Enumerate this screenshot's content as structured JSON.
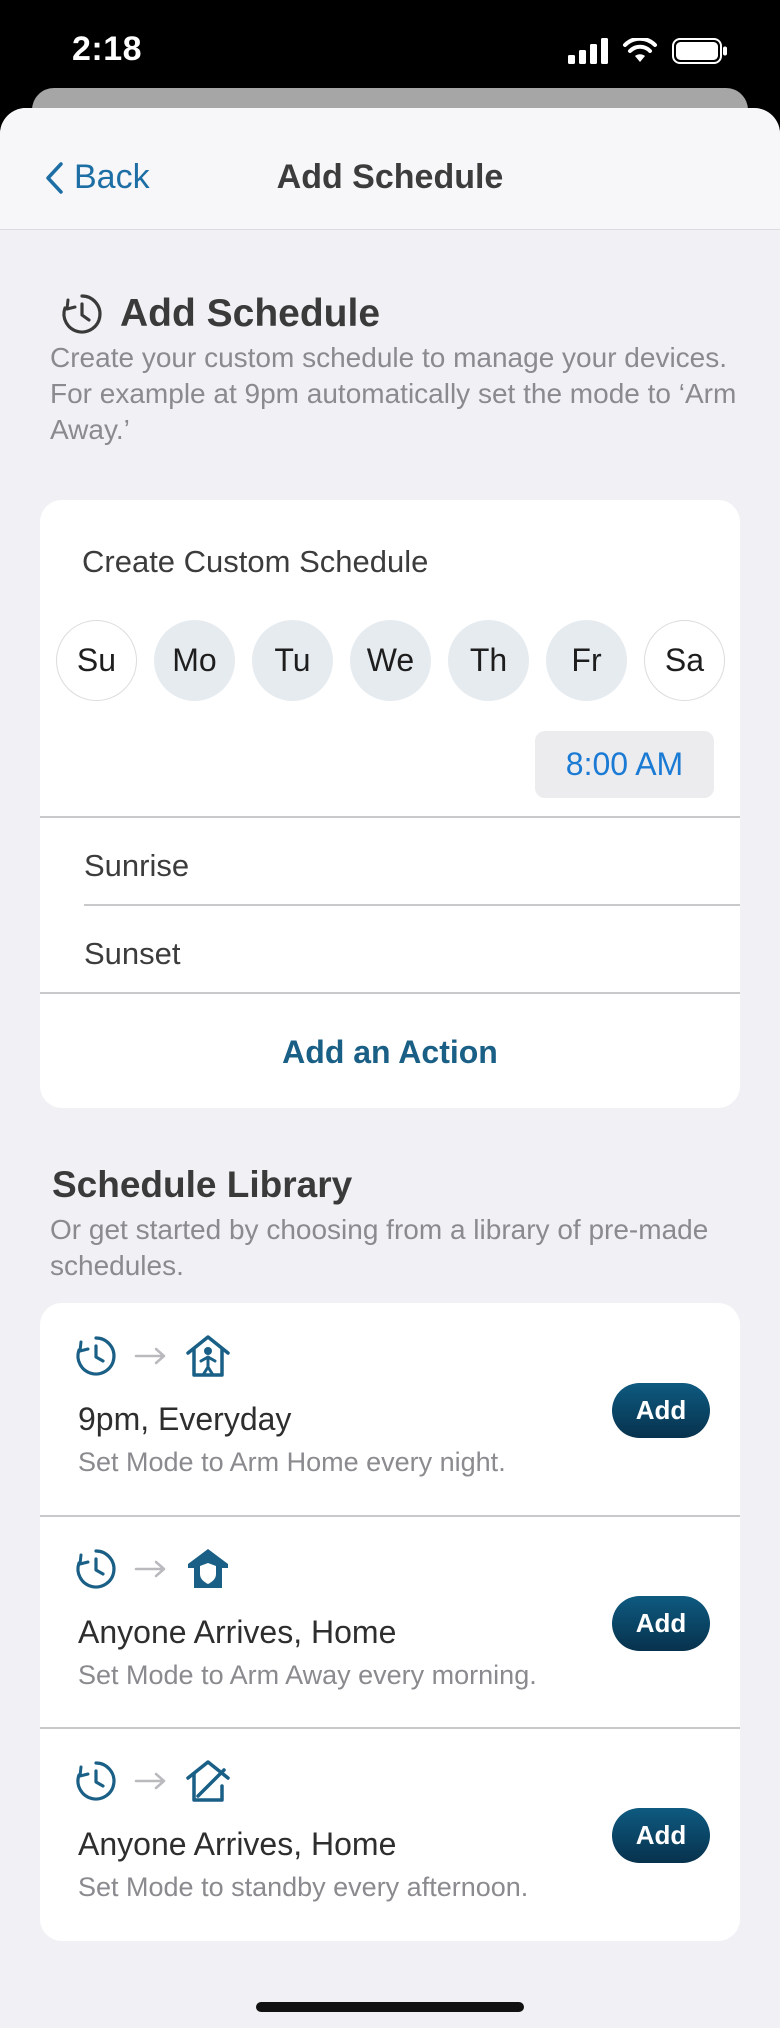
{
  "status": {
    "time": "2:18"
  },
  "nav": {
    "back_label": "Back",
    "title": "Add Schedule"
  },
  "header": {
    "title": "Add Schedule",
    "description": "Create your custom schedule to manage your devices. For example at 9pm automatically set the mode to ‘Arm Away.’"
  },
  "custom": {
    "title": "Create Custom Schedule",
    "days": [
      {
        "label": "Su",
        "selected": false
      },
      {
        "label": "Mo",
        "selected": true
      },
      {
        "label": "Tu",
        "selected": true
      },
      {
        "label": "We",
        "selected": true
      },
      {
        "label": "Th",
        "selected": true
      },
      {
        "label": "Fr",
        "selected": true
      },
      {
        "label": "Sa",
        "selected": false
      }
    ],
    "time": "8:00 AM",
    "sunrise": "Sunrise",
    "sunset": "Sunset",
    "add_action": "Add an Action"
  },
  "library": {
    "title": "Schedule Library",
    "description": "Or get started by choosing from a library of pre-made schedules.",
    "items": [
      {
        "name": "9pm, Everyday",
        "desc": "Set Mode to Arm Home every night.",
        "mode_icon": "arm-home-icon",
        "button": "Add"
      },
      {
        "name": "Anyone Arrives, Home",
        "desc": "Set Mode to Arm Away every morning.",
        "mode_icon": "arm-away-icon",
        "button": "Add"
      },
      {
        "name": "Anyone Arrives, Home",
        "desc": "Set Mode to standby every afternoon.",
        "mode_icon": "standby-icon",
        "button": "Add"
      }
    ]
  },
  "colors": {
    "accent": "#1c6ea4",
    "button": "#07324d",
    "time_text": "#1a7ad4",
    "background": "#f1f1f5"
  }
}
